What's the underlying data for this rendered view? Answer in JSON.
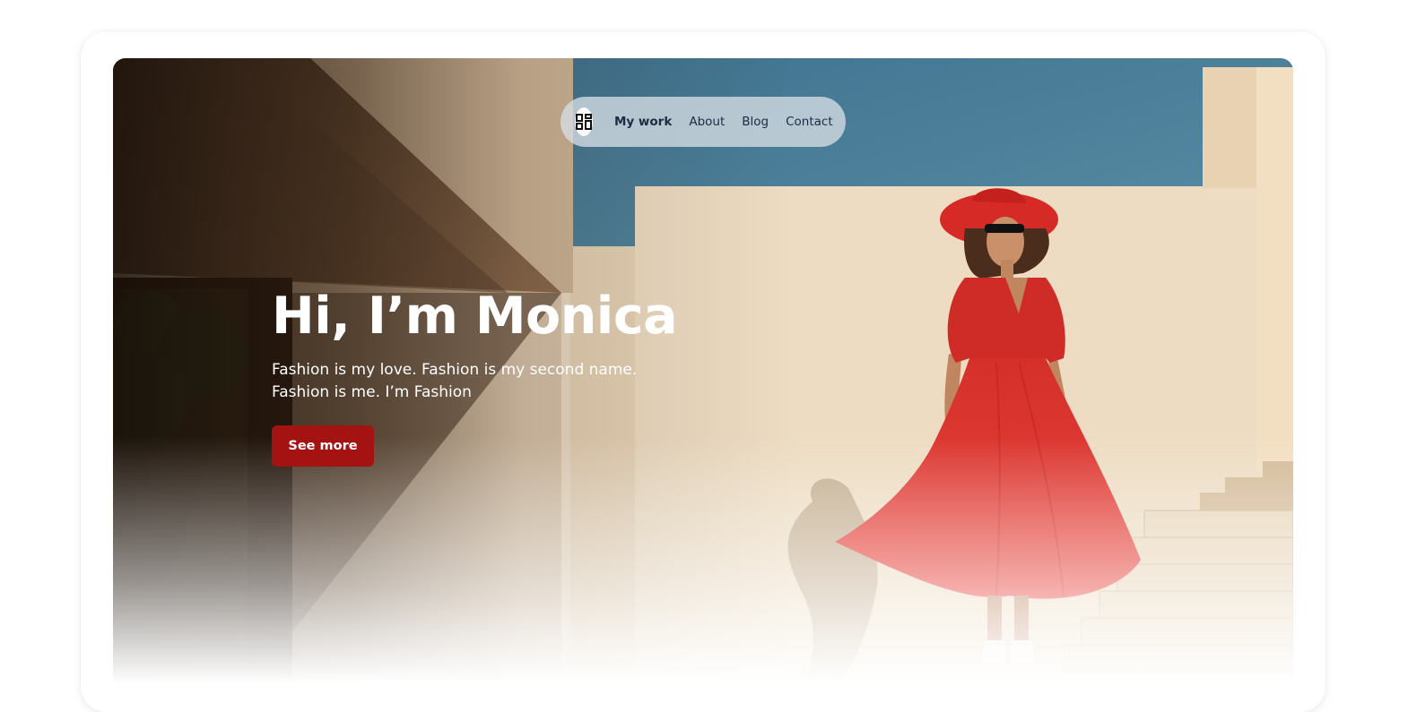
{
  "nav": {
    "logo_icon": "grid-logo-icon",
    "items": [
      {
        "label": "My work",
        "active": true
      },
      {
        "label": "About",
        "active": false
      },
      {
        "label": "Blog",
        "active": false
      },
      {
        "label": "Contact",
        "active": false
      }
    ]
  },
  "hero": {
    "headline": "Hi, I’m Monica",
    "tagline_line1": "Fashion is my love. Fashion is my second name.",
    "tagline_line2": "Fashion is me. I’m Fashion",
    "cta_label": "See more"
  },
  "colors": {
    "accent": "#a51212",
    "sky": "#4b7d97",
    "wall": "#ecdcc4",
    "dress": "#d62f2a",
    "nav_text": "#1f2a44"
  }
}
